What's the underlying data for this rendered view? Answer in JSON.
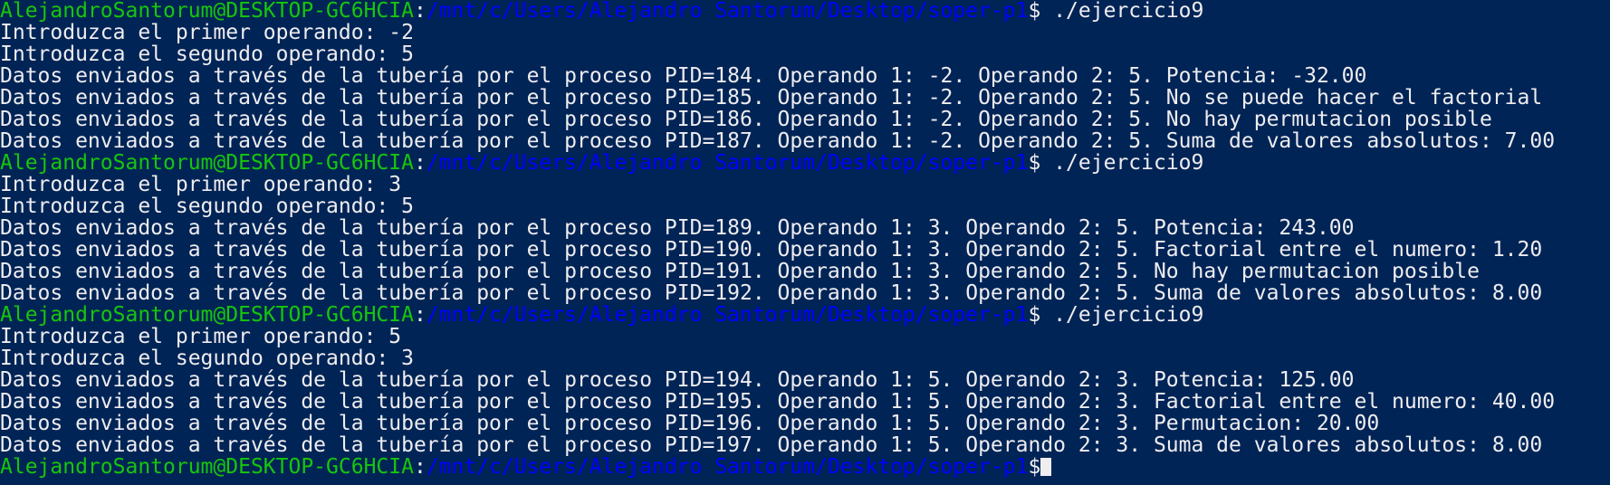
{
  "terminal": {
    "colors": {
      "background": "#012456",
      "user": "#16c60c",
      "path": "#0000ff",
      "text": "#eeedf0"
    },
    "prompt": {
      "user": "AlejandroSantorum@DESKTOP-GC6HCIA",
      "colon": ":",
      "path": "/mnt/c/Users/Alejandro Santorum/Desktop/soper-p1",
      "symbol": "$"
    },
    "lines": [
      {
        "type": "prompt",
        "cmd": " ./ejercicio9"
      },
      {
        "type": "out",
        "text": "Introduzca el primer operando: -2"
      },
      {
        "type": "out",
        "text": "Introduzca el segundo operando: 5"
      },
      {
        "type": "out",
        "text": "Datos enviados a través de la tubería por el proceso PID=184. Operando 1: -2. Operando 2: 5. Potencia: -32.00"
      },
      {
        "type": "out",
        "text": "Datos enviados a través de la tubería por el proceso PID=185. Operando 1: -2. Operando 2: 5. No se puede hacer el factorial"
      },
      {
        "type": "out",
        "text": "Datos enviados a través de la tubería por el proceso PID=186. Operando 1: -2. Operando 2: 5. No hay permutacion posible"
      },
      {
        "type": "out",
        "text": "Datos enviados a través de la tubería por el proceso PID=187. Operando 1: -2. Operando 2: 5. Suma de valores absolutos: 7.00"
      },
      {
        "type": "prompt",
        "cmd": " ./ejercicio9"
      },
      {
        "type": "out",
        "text": "Introduzca el primer operando: 3"
      },
      {
        "type": "out",
        "text": "Introduzca el segundo operando: 5"
      },
      {
        "type": "out",
        "text": "Datos enviados a través de la tubería por el proceso PID=189. Operando 1: 3. Operando 2: 5. Potencia: 243.00"
      },
      {
        "type": "out",
        "text": "Datos enviados a través de la tubería por el proceso PID=190. Operando 1: 3. Operando 2: 5. Factorial entre el numero: 1.20"
      },
      {
        "type": "out",
        "text": "Datos enviados a través de la tubería por el proceso PID=191. Operando 1: 3. Operando 2: 5. No hay permutacion posible"
      },
      {
        "type": "out",
        "text": "Datos enviados a través de la tubería por el proceso PID=192. Operando 1: 3. Operando 2: 5. Suma de valores absolutos: 8.00"
      },
      {
        "type": "prompt",
        "cmd": " ./ejercicio9"
      },
      {
        "type": "out",
        "text": "Introduzca el primer operando: 5"
      },
      {
        "type": "out",
        "text": "Introduzca el segundo operando: 3"
      },
      {
        "type": "out",
        "text": "Datos enviados a través de la tubería por el proceso PID=194. Operando 1: 5. Operando 2: 3. Potencia: 125.00"
      },
      {
        "type": "out",
        "text": "Datos enviados a través de la tubería por el proceso PID=195. Operando 1: 5. Operando 2: 3. Factorial entre el numero: 40.00"
      },
      {
        "type": "out",
        "text": "Datos enviados a través de la tubería por el proceso PID=196. Operando 1: 5. Operando 2: 3. Permutacion: 20.00"
      },
      {
        "type": "out",
        "text": "Datos enviados a través de la tubería por el proceso PID=197. Operando 1: 5. Operando 2: 3. Suma de valores absolutos: 8.00"
      },
      {
        "type": "prompt",
        "cmd": "",
        "cursor": true
      }
    ]
  }
}
